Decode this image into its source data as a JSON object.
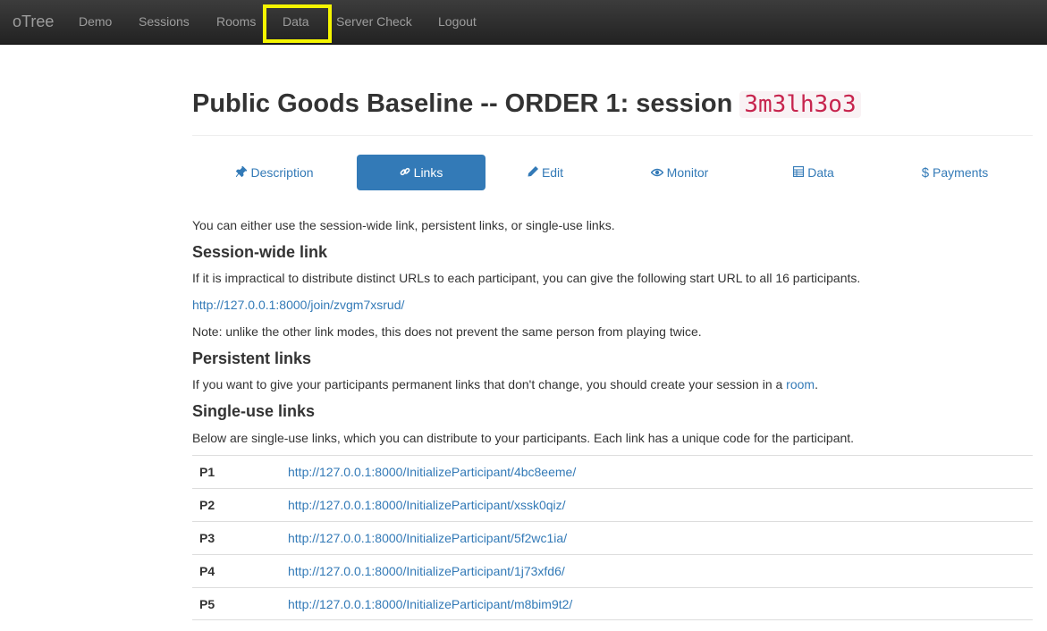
{
  "navbar": {
    "brand": "oTree",
    "items": [
      "Demo",
      "Sessions",
      "Rooms",
      "Data",
      "Server Check",
      "Logout"
    ]
  },
  "title": {
    "prefix": "Public Goods Baseline -- ORDER 1: session",
    "code": "3m3lh3o3"
  },
  "tabs": [
    {
      "label": "Description",
      "icon": "pushpin-icon",
      "glyph": "📌"
    },
    {
      "label": "Links",
      "icon": "link-icon",
      "glyph": "🔗"
    },
    {
      "label": "Edit",
      "icon": "pencil-icon",
      "glyph": "✏"
    },
    {
      "label": "Monitor",
      "icon": "eye-icon",
      "glyph": "👁"
    },
    {
      "label": "Data",
      "icon": "table-icon",
      "glyph": "▤"
    },
    {
      "label": "Payments",
      "icon": "dollar-icon",
      "glyph": "$"
    }
  ],
  "content": {
    "intro": "You can either use the session-wide link, persistent links, or single-use links.",
    "session_wide_heading": "Session-wide link",
    "session_wide_text": "If it is impractical to distribute distinct URLs to each participant, you can give the following start URL to all 16 participants.",
    "session_wide_url": "http://127.0.0.1:8000/join/zvgm7xsrud/",
    "session_wide_note": "Note: unlike the other link modes, this does not prevent the same person from playing twice.",
    "persistent_heading": "Persistent links",
    "persistent_text_before": "If you want to give your participants permanent links that don't change, you should create your session in a ",
    "persistent_link": "room",
    "persistent_text_after": ".",
    "single_use_heading": "Single-use links",
    "single_use_text": "Below are single-use links, which you can distribute to your participants. Each link has a unique code for the participant."
  },
  "participants": [
    {
      "id": "P1",
      "url": "http://127.0.0.1:8000/InitializeParticipant/4bc8eeme/"
    },
    {
      "id": "P2",
      "url": "http://127.0.0.1:8000/InitializeParticipant/xssk0qiz/"
    },
    {
      "id": "P3",
      "url": "http://127.0.0.1:8000/InitializeParticipant/5f2wc1ia/"
    },
    {
      "id": "P4",
      "url": "http://127.0.0.1:8000/InitializeParticipant/1j73xfd6/"
    },
    {
      "id": "P5",
      "url": "http://127.0.0.1:8000/InitializeParticipant/m8bim9t2/"
    }
  ]
}
